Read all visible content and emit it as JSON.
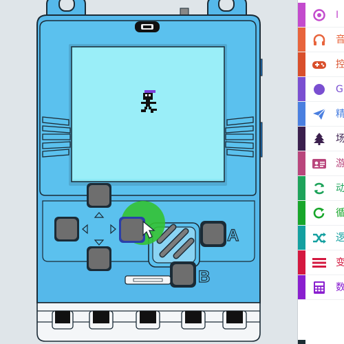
{
  "simulator": {
    "buttons": {
      "a_label": "A",
      "b_label": "B"
    },
    "colors": {
      "body": "#55b8ea",
      "screen": "#8de9f5",
      "hover": "#33c233"
    }
  },
  "toolbox": {
    "categories": [
      {
        "label": "I",
        "color": "#c34bcd",
        "icon": "circle-dot-icon"
      },
      {
        "label": "音",
        "color": "#e8643c",
        "icon": "headphones-icon"
      },
      {
        "label": "控",
        "color": "#d94f2b",
        "icon": "gamepad-icon"
      },
      {
        "label": "G",
        "color": "#7a4fd1",
        "icon": "circle-icon"
      },
      {
        "label": "精",
        "color": "#4a7fe0",
        "icon": "paper-plane-icon"
      },
      {
        "label": "场",
        "color": "#3b1f4d",
        "icon": "tree-icon"
      },
      {
        "label": "游",
        "color": "#b9467c",
        "icon": "id-card-icon"
      },
      {
        "label": "动",
        "color": "#1ea35a",
        "icon": "sync-icon"
      },
      {
        "label": "循",
        "color": "#17a62a",
        "icon": "redo-icon"
      },
      {
        "label": "逻",
        "color": "#14a0a0",
        "icon": "shuffle-icon"
      },
      {
        "label": "变",
        "color": "#d4183f",
        "icon": "list-icon"
      },
      {
        "label": "数",
        "color": "#8a1fcf",
        "icon": "calculator-icon"
      }
    ]
  }
}
